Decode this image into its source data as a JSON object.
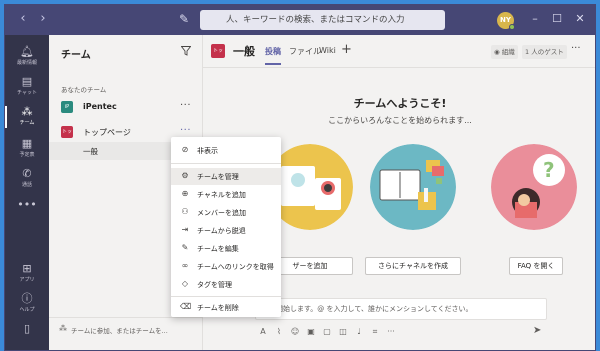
{
  "titlebar": {
    "back_icon": "chevron-left-icon",
    "forward_icon": "chevron-right-icon",
    "compose_icon": "compose-icon",
    "search_placeholder": "人、キーワードの検索、またはコマンドの入力",
    "avatar_initials": "NY"
  },
  "rail": {
    "items": [
      {
        "label": "最新情報",
        "icon": "bell-icon"
      },
      {
        "label": "チャット",
        "icon": "chat-icon"
      },
      {
        "label": "チーム",
        "icon": "teams-icon"
      },
      {
        "label": "予定表",
        "icon": "calendar-icon"
      },
      {
        "label": "通話",
        "icon": "phone-icon"
      },
      {
        "label": "",
        "icon": "more-icon"
      },
      {
        "label": "アプリ",
        "icon": "apps-icon"
      },
      {
        "label": "ヘルプ",
        "icon": "help-icon"
      },
      {
        "label": "",
        "icon": "mobile-icon"
      }
    ],
    "active_index": 2
  },
  "teams_pane": {
    "title": "チーム",
    "section_label": "あなたのチーム",
    "teams": [
      {
        "name": "iPentec",
        "tile_color": "#2a8a7e",
        "tile_text": "iP"
      },
      {
        "name": "トップページ",
        "tile_color": "#c4314b",
        "tile_text": "トッ"
      }
    ],
    "channel": "一般",
    "join_text": "チームに参加、またはチームを..."
  },
  "channel_header": {
    "title": "一般",
    "tile_text": "トッ",
    "tabs": [
      "投稿",
      "ファイル",
      "Wiki"
    ],
    "active_tab": 0,
    "view_button": "組織",
    "guest_button": "1 人のゲスト"
  },
  "welcome": {
    "title": "チームへようこそ!",
    "subtitle": "ここからいろんなことを始められます...",
    "buttons": [
      "ザーを追加",
      "さらにチャネルを作成",
      "FAQ を開く"
    ]
  },
  "compose": {
    "placeholder": "話を開始します。@ を入力して、誰かにメンションしてください。"
  },
  "context_menu": {
    "items": [
      {
        "label": "非表示",
        "icon": "hide-icon"
      },
      {
        "label": "チームを管理",
        "icon": "gear-icon"
      },
      {
        "label": "チャネルを追加",
        "icon": "add-channel-icon"
      },
      {
        "label": "メンバーを追加",
        "icon": "add-member-icon"
      },
      {
        "label": "チームから脱退",
        "icon": "leave-icon"
      },
      {
        "label": "チームを編集",
        "icon": "pencil-icon"
      },
      {
        "label": "チームへのリンクを取得",
        "icon": "link-icon"
      },
      {
        "label": "タグを管理",
        "icon": "tag-icon"
      },
      {
        "label": "チームを削除",
        "icon": "trash-icon"
      }
    ],
    "highlighted_index": 1
  },
  "colors": {
    "titlebar": "#464775",
    "rail": "#33344a",
    "accent": "#6264a7",
    "team_red": "#c4314b"
  }
}
